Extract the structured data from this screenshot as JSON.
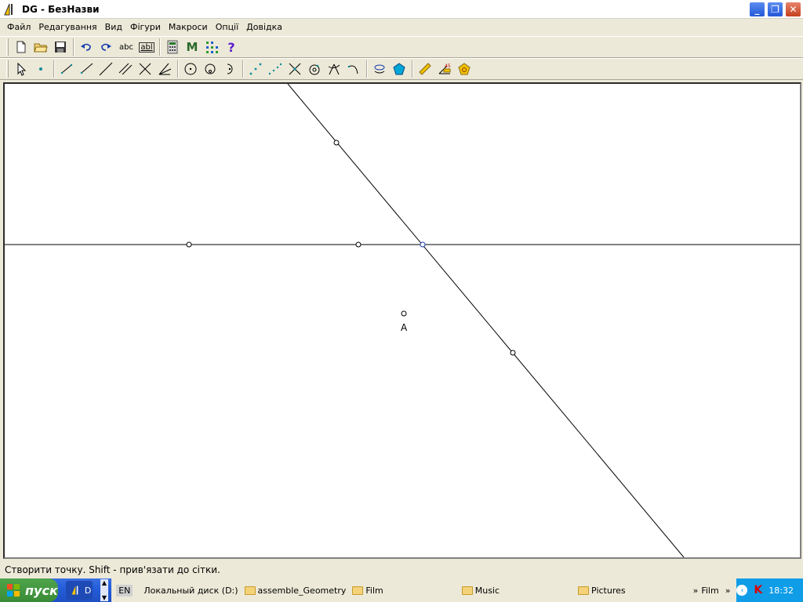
{
  "window": {
    "title": "DG - БезНазви",
    "buttons": {
      "minimize": "_",
      "maximize": "❐",
      "close": "✕"
    }
  },
  "menu": [
    "Файл",
    "Редагування",
    "Вид",
    "Фігури",
    "Макроси",
    "Опції",
    "Довідка"
  ],
  "toolbar1": {
    "icons": [
      "new-file-icon",
      "open-folder-icon",
      "save-icon",
      "undo-icon",
      "redo-icon",
      "text-abc-icon",
      "label-abl-icon",
      "calculator-icon",
      "macro-m-icon",
      "grid-dots-icon",
      "help-question-icon"
    ],
    "abc_label": "abc",
    "abl_label": "abl",
    "m_label": "M",
    "help_label": "?"
  },
  "toolbar2": {
    "icons": [
      "select-arrow-icon",
      "point-icon",
      "segment-icon",
      "ray-icon",
      "line-icon",
      "parallel-icon",
      "perpendicular-icon",
      "angle-bisector-icon",
      "circle-center-icon",
      "circle-three-points-icon",
      "arc-icon",
      "midpoint-icon",
      "divide-segment-icon",
      "intersection-icon",
      "point-on-circle-icon",
      "compass-icon",
      "curve-icon",
      "locus-icon",
      "polygon-icon",
      "ruler-icon",
      "measure-icon",
      "macro-gear-icon"
    ]
  },
  "canvas": {
    "point_label": "A"
  },
  "status": "Створити точку. Shift - прив'язати до сітки.",
  "taskbar": {
    "start": "пуск",
    "app": "D",
    "lang": "EN",
    "drive": "Локальный диск (D:)",
    "folders": [
      "assemble_Geometry",
      "Film",
      "Music",
      "Pictures"
    ],
    "more": "»",
    "film_label": "Film",
    "time": "18:32"
  }
}
